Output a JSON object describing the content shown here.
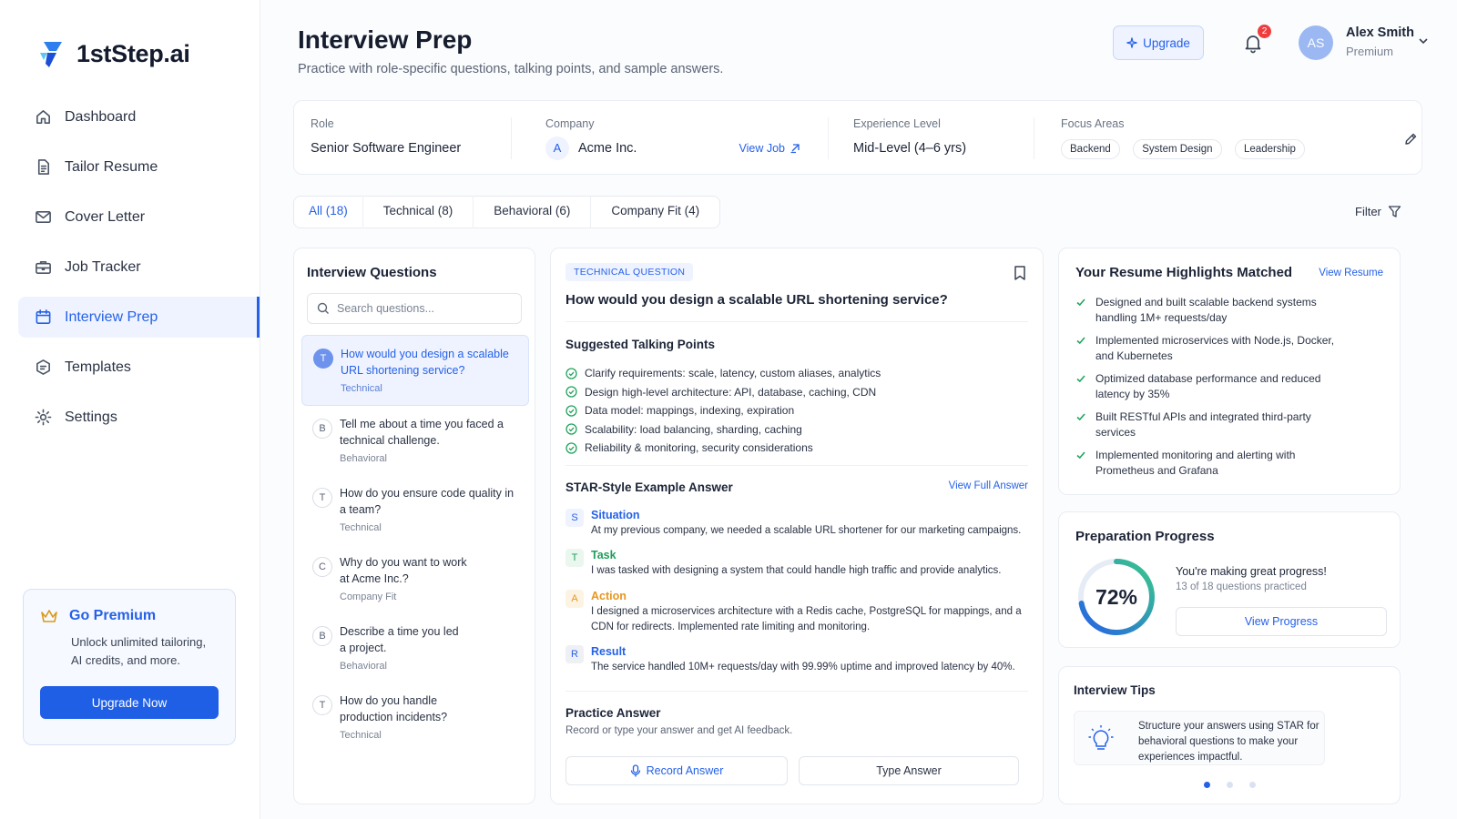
{
  "brand": {
    "name": "1stStep.ai"
  },
  "sidebar": {
    "items": [
      {
        "label": "Dashboard"
      },
      {
        "label": "Tailor Resume"
      },
      {
        "label": "Cover Letter"
      },
      {
        "label": "Job Tracker"
      },
      {
        "label": "Interview Prep"
      },
      {
        "label": "Templates"
      },
      {
        "label": "Settings"
      }
    ],
    "active_index": 4
  },
  "premium": {
    "title": "Go Premium",
    "text": "Unlock unlimited tailoring, AI credits, and more.",
    "button": "Upgrade Now"
  },
  "header": {
    "title": "Interview Prep",
    "subtitle": "Practice with role-specific questions, talking points, and sample answers.",
    "upgrade_label": "Upgrade",
    "notifications_count": "2",
    "user": {
      "initials": "AS",
      "name": "Alex Smith",
      "plan": "Premium"
    }
  },
  "job": {
    "role_label": "Role",
    "role": "Senior Software Engineer",
    "company_label": "Company",
    "company_initial": "A",
    "company": "Acme Inc.",
    "view_job": "View Job",
    "experience_label": "Experience Level",
    "experience": "Mid-Level (4–6 yrs)",
    "focus_label": "Focus Areas",
    "focus_areas": [
      "Backend",
      "System Design",
      "Leadership"
    ]
  },
  "tabs": [
    {
      "label": "All (18)"
    },
    {
      "label": "Technical (8)"
    },
    {
      "label": "Behavioral (6)"
    },
    {
      "label": "Company Fit (4)"
    }
  ],
  "filter_label": "Filter",
  "questions": {
    "title": "Interview Questions",
    "search_placeholder": "Search questions...",
    "items": [
      {
        "letter": "T",
        "text": "How would you design a scalable URL shortening service?",
        "category": "Technical"
      },
      {
        "letter": "B",
        "text": "Tell me about a time you faced a technical challenge.",
        "category": "Behavioral"
      },
      {
        "letter": "T",
        "text": "How do you ensure code quality in a team?",
        "category": "Technical"
      },
      {
        "letter": "C",
        "text": "Why do you want to work at Acme Inc.?",
        "category": "Company Fit"
      },
      {
        "letter": "B",
        "text": "Describe a time you led a project.",
        "category": "Behavioral"
      },
      {
        "letter": "T",
        "text": "How do you handle production incidents?",
        "category": "Technical"
      }
    ]
  },
  "detail": {
    "tag": "TECHNICAL QUESTION",
    "question": "How would you design a scalable URL shortening service?",
    "talking_title": "Suggested Talking Points",
    "talking_points": [
      "Clarify requirements: scale, latency, custom aliases, analytics",
      "Design high-level architecture: API, database, caching, CDN",
      "Data model: mappings, indexing, expiration",
      "Scalability: load balancing, sharding, caching",
      "Reliability & monitoring, security considerations"
    ],
    "star_title": "STAR-Style Example Answer",
    "view_full": "View Full Answer",
    "star": [
      {
        "letter": "S",
        "name": "Situation",
        "text": "At my previous company, we needed a scalable URL shortener for our marketing campaigns.",
        "color": "#2561e8",
        "bg": "#eef3ff"
      },
      {
        "letter": "T",
        "name": "Task",
        "text": "I was tasked with designing a system that could handle high traffic and provide analytics.",
        "color": "#1e9e5a",
        "bg": "#e9f7ef"
      },
      {
        "letter": "A",
        "name": "Action",
        "text": "I designed a microservices architecture with a Redis cache, PostgreSQL for mappings, and a CDN for redirects. Implemented rate limiting and monitoring.",
        "color": "#e8961e",
        "bg": "#fdf3e3"
      },
      {
        "letter": "R",
        "name": "Result",
        "text": "The service handled 10M+ requests/day with 99.99% uptime and improved latency by 40%.",
        "color": "#2561e8",
        "bg": "#eef0f6"
      }
    ],
    "practice_title": "Practice Answer",
    "practice_sub": "Record or type your answer and get AI feedback.",
    "record_label": "Record Answer",
    "type_label": "Type Answer"
  },
  "highlights": {
    "title": "Your Resume Highlights Matched",
    "view_resume": "View Resume",
    "items": [
      "Designed and built scalable backend systems handling 1M+ requests/day",
      "Implemented microservices with Node.js, Docker, and Kubernetes",
      "Optimized database performance and reduced latency by 35%",
      "Built RESTful APIs and integrated third-party services",
      "Implemented monitoring and alerting with Prometheus and Grafana"
    ]
  },
  "progress": {
    "title": "Preparation Progress",
    "percent_label": "72%",
    "percent": 72,
    "message": "You're making great progress!",
    "detail": "13 of 18 questions practiced",
    "button": "View Progress"
  },
  "tips": {
    "title": "Interview Tips",
    "text": "Structure your answers using STAR for behavioral questions to make your experiences impactful."
  },
  "colors": {
    "accent": "#2561e8",
    "success": "#22a45d",
    "badge": "#ef3c3c"
  }
}
